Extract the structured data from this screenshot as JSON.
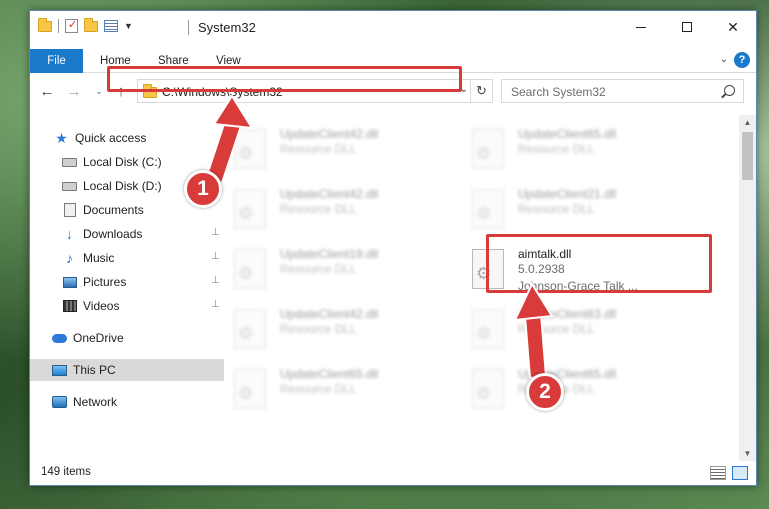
{
  "window": {
    "title": "System32",
    "buttons": {
      "minimize": "minimize",
      "maximize": "maximize",
      "close": "✕"
    }
  },
  "ribbon": {
    "tabs": [
      "File",
      "Home",
      "Share",
      "View"
    ],
    "help": "?"
  },
  "navigation": {
    "back": "←",
    "forward": "→",
    "recent": "⌄",
    "up": "↑",
    "address": "C:\\Windows\\System32",
    "address_dropdown": "⌄",
    "refresh": "↻",
    "search_placeholder": "Search System32"
  },
  "sidebar": {
    "items": [
      {
        "label": "Quick access",
        "icon": "star-icon"
      },
      {
        "label": "Local Disk (C:)",
        "icon": "drive-icon"
      },
      {
        "label": "Local Disk (D:)",
        "icon": "drive-icon"
      },
      {
        "label": "Documents",
        "icon": "documents-icon"
      },
      {
        "label": "Downloads",
        "icon": "download-icon",
        "pinned": true
      },
      {
        "label": "Music",
        "icon": "music-icon",
        "pinned": true
      },
      {
        "label": "Pictures",
        "icon": "pictures-icon",
        "pinned": true
      },
      {
        "label": "Videos",
        "icon": "videos-icon",
        "pinned": true
      },
      {
        "label": "OneDrive",
        "icon": "cloud-icon"
      },
      {
        "label": "This PC",
        "icon": "pc-icon",
        "selected": true
      },
      {
        "label": "Network",
        "icon": "network-icon"
      }
    ],
    "pin_glyph": "📌"
  },
  "files": {
    "background": [
      {
        "name": "UpdateClient42.dll",
        "desc": "Resource DLL"
      },
      {
        "name": "UpdateClient65.dll",
        "desc": "Resource DLL"
      },
      {
        "name": "UpdateClient42.dll",
        "desc": "Resource DLL"
      },
      {
        "name": "UpdateClient21.dll",
        "desc": "Resource DLL"
      },
      {
        "name": "UpdateClient19.dll",
        "desc": "Resource DLL"
      },
      {
        "name": "UpdateClient42.dll",
        "desc": "Resource DLL"
      },
      {
        "name": "UpdateClient63.dll",
        "desc": "Resource DLL"
      },
      {
        "name": "UpdateClient65.dll",
        "desc": "Resource DLL"
      },
      {
        "name": "UpdateClient65.dll",
        "desc": "Resource DLL"
      }
    ],
    "target": {
      "name": "aimtalk.dll",
      "version": "5.0.2938",
      "company": "Johnson-Grace Talk ..."
    }
  },
  "status": {
    "item_count": "149 items"
  },
  "annotations": {
    "step1": "1",
    "step2": "2",
    "color": "#d93a3a"
  },
  "colors": {
    "accent": "#1979ca",
    "selection": "#d9d9d9",
    "highlight": "#d93a3a"
  }
}
